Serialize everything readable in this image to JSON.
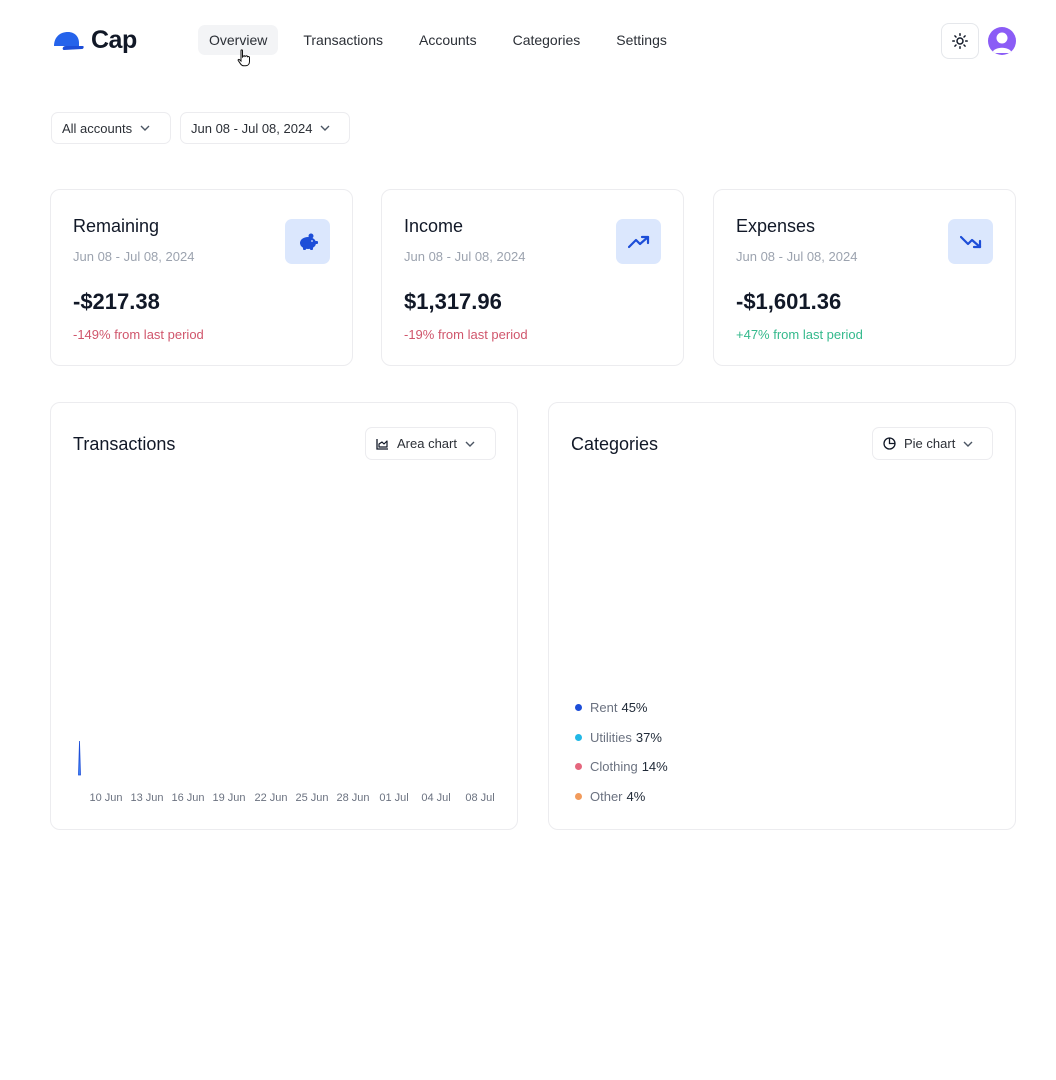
{
  "app": {
    "name": "Cap"
  },
  "nav": [
    {
      "label": "Overview",
      "active": true
    },
    {
      "label": "Transactions",
      "active": false
    },
    {
      "label": "Accounts",
      "active": false
    },
    {
      "label": "Categories",
      "active": false
    },
    {
      "label": "Settings",
      "active": false
    }
  ],
  "header": {
    "theme_icon": "sun-icon",
    "avatar_icon": "user-icon"
  },
  "filters": {
    "account": "All accounts",
    "date_range": "Jun 08 - Jul 08, 2024"
  },
  "stats": [
    {
      "title": "Remaining",
      "date": "Jun 08 - Jul 08, 2024",
      "value": "-$217.38",
      "delta": "-149% from last period",
      "delta_color": "#d0566c",
      "icon": "piggy-bank-icon"
    },
    {
      "title": "Income",
      "date": "Jun 08 - Jul 08, 2024",
      "value": "$1,317.96",
      "delta": "-19% from last period",
      "delta_color": "#d0566c",
      "icon": "trending-up-icon"
    },
    {
      "title": "Expenses",
      "date": "Jun 08 - Jul 08, 2024",
      "value": "-$1,601.36",
      "delta": "+47% from last period",
      "delta_color": "#34b98c",
      "icon": "trending-down-icon"
    }
  ],
  "transactions_panel": {
    "title": "Transactions",
    "chart_type_label": "Area chart",
    "icon": "area-chart-icon"
  },
  "categories_panel": {
    "title": "Categories",
    "chart_type_label": "Pie chart",
    "icon": "pie-chart-icon"
  },
  "colors": {
    "accent": "#2563eb",
    "icon_bg": "#dbe7fd",
    "negative": "#d0566c",
    "positive": "#34b98c",
    "avatar": "#8b5cf6"
  },
  "chart_data": [
    {
      "type": "area",
      "title": "Transactions",
      "x_tick_labels": [
        "10 Jun",
        "13 Jun",
        "16 Jun",
        "19 Jun",
        "22 Jun",
        "25 Jun",
        "28 Jun",
        "01 Jul",
        "04 Jul",
        "08 Jul"
      ],
      "series": [],
      "note_visible_mark": "single thin spike near 09 Jun"
    },
    {
      "type": "pie",
      "title": "Categories",
      "legend_position": "bottom-left",
      "slices": [
        {
          "label": "Rent",
          "percent_label": "45%",
          "value": 45,
          "color": "#1d4ed8"
        },
        {
          "label": "Utilities",
          "percent_label": "37%",
          "value": 37,
          "color": "#22b8e6"
        },
        {
          "label": "Clothing",
          "percent_label": "14%",
          "value": 14,
          "color": "#e5677e"
        },
        {
          "label": "Other",
          "percent_label": "4%",
          "value": 4,
          "color": "#f29b5c"
        }
      ]
    }
  ]
}
